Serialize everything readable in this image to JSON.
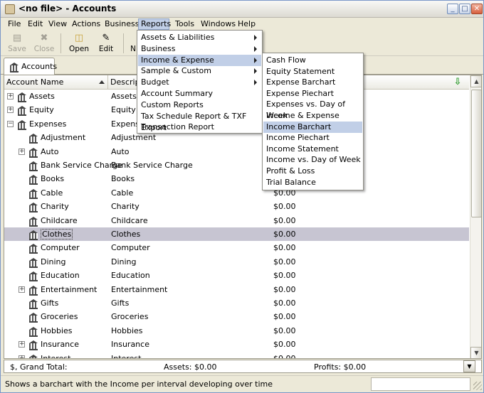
{
  "window": {
    "title": "<no file> - Accounts",
    "min": "_",
    "max": "□",
    "close": "✕"
  },
  "menubar": [
    "File",
    "Edit",
    "View",
    "Actions",
    "Business",
    "Reports",
    "Tools",
    "Windows",
    "Help"
  ],
  "toolbar": {
    "save": "Save",
    "close": "Close",
    "open": "Open",
    "edit": "Edit",
    "new": "N"
  },
  "tab": {
    "label": "Accounts"
  },
  "columns": {
    "name": "Account Name",
    "description": "Descripti"
  },
  "rows": [
    {
      "name": "Assets",
      "desc": "Assets",
      "total": ""
    },
    {
      "name": "Equity",
      "desc": "Equity",
      "total": ""
    },
    {
      "name": "Expenses",
      "desc": "Expense",
      "total": ""
    },
    {
      "name": "Adjustment",
      "desc": "Adjustment",
      "total": ""
    },
    {
      "name": "Auto",
      "desc": "Auto",
      "total": ""
    },
    {
      "name": "Bank Service Charge",
      "desc": "Bank Service Charge",
      "total": ""
    },
    {
      "name": "Books",
      "desc": "Books",
      "total": ""
    },
    {
      "name": "Cable",
      "desc": "Cable",
      "total": "$0.00"
    },
    {
      "name": "Charity",
      "desc": "Charity",
      "total": "$0.00"
    },
    {
      "name": "Childcare",
      "desc": "Childcare",
      "total": "$0.00"
    },
    {
      "name": "Clothes",
      "desc": "Clothes",
      "total": "$0.00"
    },
    {
      "name": "Computer",
      "desc": "Computer",
      "total": "$0.00"
    },
    {
      "name": "Dining",
      "desc": "Dining",
      "total": "$0.00"
    },
    {
      "name": "Education",
      "desc": "Education",
      "total": "$0.00"
    },
    {
      "name": "Entertainment",
      "desc": "Entertainment",
      "total": "$0.00"
    },
    {
      "name": "Gifts",
      "desc": "Gifts",
      "total": "$0.00"
    },
    {
      "name": "Groceries",
      "desc": "Groceries",
      "total": "$0.00"
    },
    {
      "name": "Hobbies",
      "desc": "Hobbies",
      "total": "$0.00"
    },
    {
      "name": "Insurance",
      "desc": "Insurance",
      "total": "$0.00"
    },
    {
      "name": "Interest",
      "desc": "Interest",
      "total": "$0.00"
    }
  ],
  "reports_menu": [
    "Assets & Liabilities",
    "Business",
    "Income & Expense",
    "Sample & Custom",
    "Budget",
    "Account Summary",
    "Custom Reports",
    "Tax Schedule Report & TXF Export",
    "Transaction Report"
  ],
  "income_expense_menu": [
    "Cash Flow",
    "Equity Statement",
    "Expense Barchart",
    "Expense Piechart",
    "Expenses vs. Day of Week",
    "Income & Expense Chart",
    "Income Barchart",
    "Income Piechart",
    "Income Statement",
    "Income vs. Day of Week",
    "Profit & Loss",
    "Trial Balance"
  ],
  "totals": {
    "label": "$, Grand Total:",
    "assets": "Assets: $0.00",
    "profits": "Profits: $0.00"
  },
  "status": "Shows a barchart with the Income per interval developing over time"
}
